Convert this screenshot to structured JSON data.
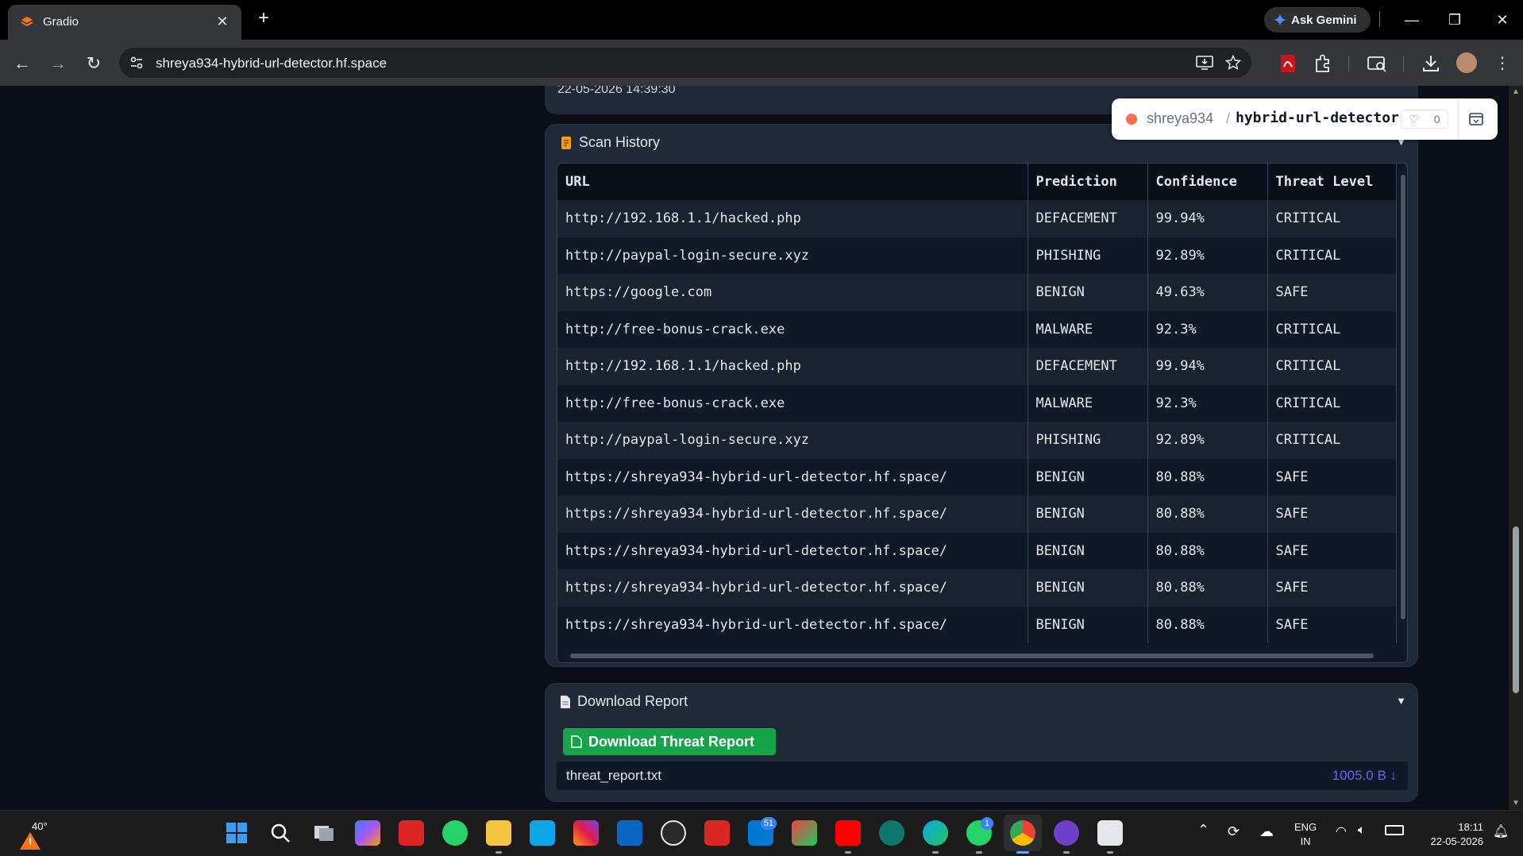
{
  "browser": {
    "tab_title": "Gradio",
    "new_tab": "+",
    "close_tab": "✕",
    "gemini_label": "Ask Gemini",
    "url": "shreya934-hybrid-url-detector.hf.space"
  },
  "previous": {
    "timestamp": "22-05-2026 14:39:30"
  },
  "hf_badge": {
    "owner": "shreya934",
    "repo": "hybrid-url-detector",
    "likes": "0"
  },
  "scan_history": {
    "title": "Scan History",
    "columns": [
      "URL",
      "Prediction",
      "Confidence",
      "Threat Level"
    ],
    "rows": [
      [
        "http://192.168.1.1/hacked.php",
        "DEFACEMENT",
        "99.94%",
        "CRITICAL"
      ],
      [
        "http://paypal-login-secure.xyz",
        "PHISHING",
        "92.89%",
        "CRITICAL"
      ],
      [
        "https://google.com",
        "BENIGN",
        "49.63%",
        "SAFE"
      ],
      [
        "http://free-bonus-crack.exe",
        "MALWARE",
        "92.3%",
        "CRITICAL"
      ],
      [
        "http://192.168.1.1/hacked.php",
        "DEFACEMENT",
        "99.94%",
        "CRITICAL"
      ],
      [
        "http://free-bonus-crack.exe",
        "MALWARE",
        "92.3%",
        "CRITICAL"
      ],
      [
        "http://paypal-login-secure.xyz",
        "PHISHING",
        "92.89%",
        "CRITICAL"
      ],
      [
        "https://shreya934-hybrid-url-detector.hf.space/",
        "BENIGN",
        "80.88%",
        "SAFE"
      ],
      [
        "https://shreya934-hybrid-url-detector.hf.space/",
        "BENIGN",
        "80.88%",
        "SAFE"
      ],
      [
        "https://shreya934-hybrid-url-detector.hf.space/",
        "BENIGN",
        "80.88%",
        "SAFE"
      ],
      [
        "https://shreya934-hybrid-url-detector.hf.space/",
        "BENIGN",
        "80.88%",
        "SAFE"
      ],
      [
        "https://shreya934-hybrid-url-detector.hf.space/",
        "BENIGN",
        "80.88%",
        "SAFE"
      ]
    ]
  },
  "download_report": {
    "title": "Download Report",
    "button_label": "Download Threat Report",
    "file_name": "threat_report.txt",
    "file_size": "1005.0 B ↓"
  },
  "taskbar": {
    "temperature": "40°",
    "lang_line1": "ENG",
    "lang_line2": "IN",
    "time": "18:11",
    "date": "22-05-2026",
    "badge_mail": "51",
    "badge_whatsapp": "1"
  },
  "colors": {
    "accent_green": "#16a34a",
    "file_size_blue": "#6366f1",
    "card_bg": "#1f2937",
    "page_bg": "#0b0f19"
  }
}
